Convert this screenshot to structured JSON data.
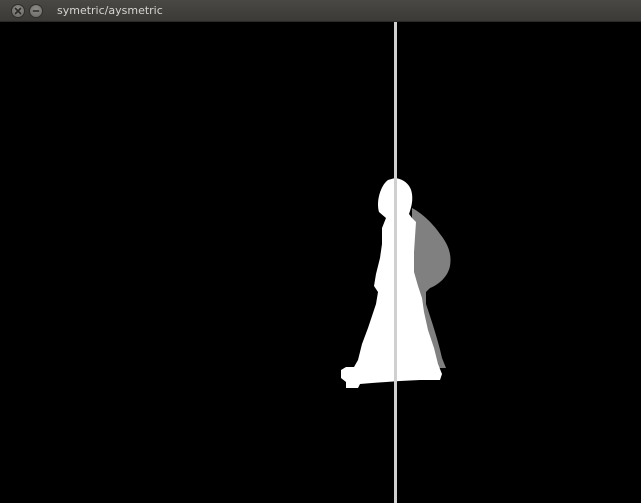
{
  "window": {
    "title": "symetric/aysmetric"
  },
  "icons": {
    "close": "close-icon",
    "minimize": "minimize-icon"
  },
  "colors": {
    "titlebar": "#3e3d39",
    "title_text": "#d7d4cf",
    "background": "#000000",
    "symmetric_region": "#ffffff",
    "asymmetric_region": "#808080",
    "symmetry_axis": "#d0d0d0"
  }
}
